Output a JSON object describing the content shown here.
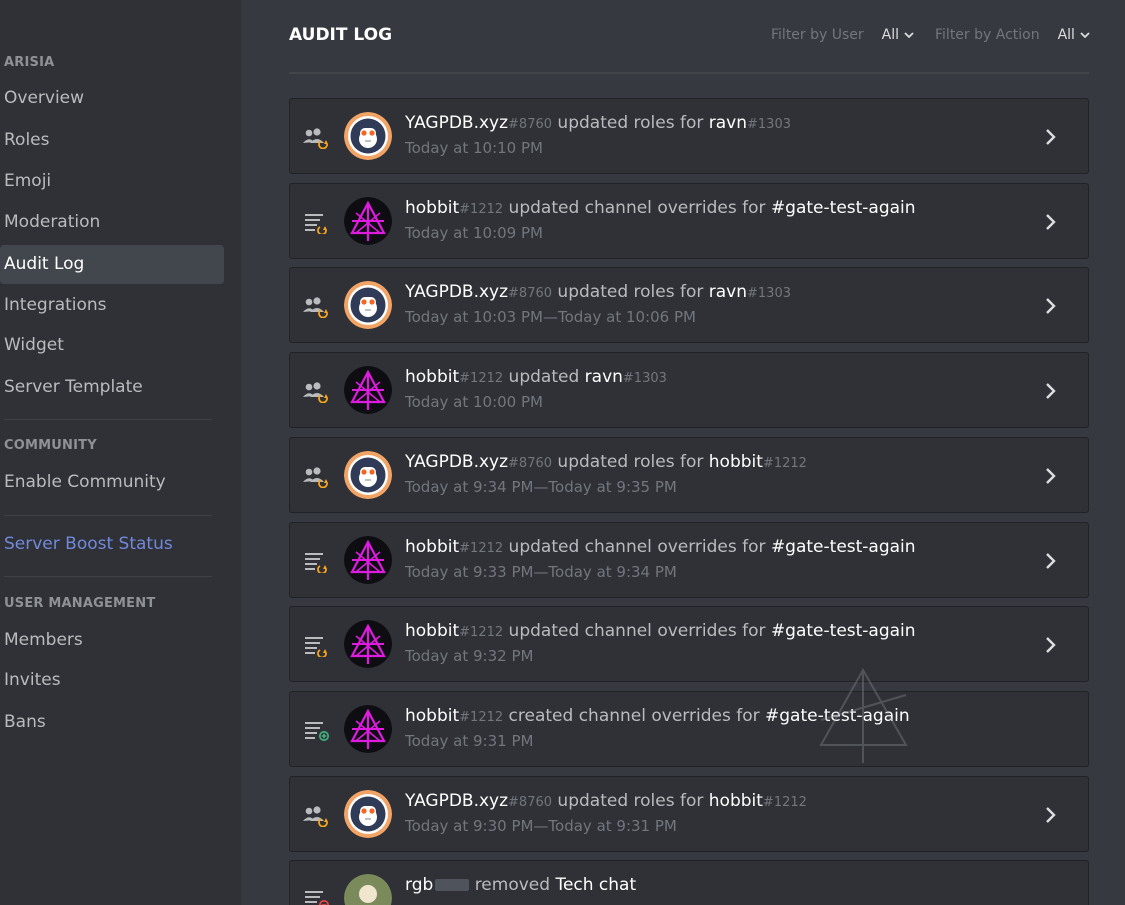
{
  "sidebar": {
    "server_name": "ARISIA",
    "server_items": [
      {
        "label": "Overview",
        "selected": false
      },
      {
        "label": "Roles",
        "selected": false
      },
      {
        "label": "Emoji",
        "selected": false
      },
      {
        "label": "Moderation",
        "selected": false
      },
      {
        "label": "Audit Log",
        "selected": true
      },
      {
        "label": "Integrations",
        "selected": false
      },
      {
        "label": "Widget",
        "selected": false
      },
      {
        "label": "Server Template",
        "selected": false
      }
    ],
    "community_header": "COMMUNITY",
    "community_items": [
      {
        "label": "Enable Community"
      }
    ],
    "boost_label": "Server Boost Status",
    "user_mgmt_header": "USER MANAGEMENT",
    "user_mgmt_items": [
      {
        "label": "Members"
      },
      {
        "label": "Invites"
      },
      {
        "label": "Bans"
      }
    ]
  },
  "header": {
    "title": "AUDIT LOG",
    "filter_user_label": "Filter by User",
    "filter_user_value": "All",
    "filter_action_label": "Filter by Action",
    "filter_action_value": "All"
  },
  "entries": [
    {
      "user": "YAGPDB.xyz",
      "discriminator": "#8760",
      "action": "updated roles for",
      "target": "ravn",
      "target_disc": "#1303",
      "time": "Today at 10:10 PM",
      "icon": "member-role-update-icon",
      "avatar": "yagpdb-avatar",
      "expandable": true
    },
    {
      "user": "hobbit",
      "discriminator": "#1212",
      "action": "updated channel overrides for",
      "target": "#gate-test-again",
      "target_disc": "",
      "time": "Today at 10:09 PM",
      "icon": "channel-override-update-icon",
      "avatar": "hobbit-avatar",
      "expandable": true
    },
    {
      "user": "YAGPDB.xyz",
      "discriminator": "#8760",
      "action": "updated roles for",
      "target": "ravn",
      "target_disc": "#1303",
      "time": "Today at 10:03 PM—Today at 10:06 PM",
      "icon": "member-role-update-icon",
      "avatar": "yagpdb-avatar",
      "expandable": true
    },
    {
      "user": "hobbit",
      "discriminator": "#1212",
      "action": "updated",
      "target": "ravn",
      "target_disc": "#1303",
      "time": "Today at 10:00 PM",
      "icon": "member-role-update-icon",
      "avatar": "hobbit-avatar",
      "expandable": true
    },
    {
      "user": "YAGPDB.xyz",
      "discriminator": "#8760",
      "action": "updated roles for",
      "target": "hobbit",
      "target_disc": "#1212",
      "time": "Today at 9:34 PM—Today at 9:35 PM",
      "icon": "member-role-update-icon",
      "avatar": "yagpdb-avatar",
      "expandable": true
    },
    {
      "user": "hobbit",
      "discriminator": "#1212",
      "action": "updated channel overrides for",
      "target": "#gate-test-again",
      "target_disc": "",
      "time": "Today at 9:33 PM—Today at 9:34 PM",
      "icon": "channel-override-update-icon",
      "avatar": "hobbit-avatar",
      "expandable": true
    },
    {
      "user": "hobbit",
      "discriminator": "#1212",
      "action": "updated channel overrides for",
      "target": "#gate-test-again",
      "target_disc": "",
      "time": "Today at 9:32 PM",
      "icon": "channel-override-update-icon",
      "avatar": "hobbit-avatar",
      "expandable": true
    },
    {
      "user": "hobbit",
      "discriminator": "#1212",
      "action": "created channel overrides for",
      "target": "#gate-test-again",
      "target_disc": "",
      "time": "Today at 9:31 PM",
      "icon": "channel-override-create-icon",
      "avatar": "hobbit-avatar",
      "expandable": false
    },
    {
      "user": "YAGPDB.xyz",
      "discriminator": "#8760",
      "action": "updated roles for",
      "target": "hobbit",
      "target_disc": "#1212",
      "time": "Today at 9:30 PM—Today at 9:31 PM",
      "icon": "member-role-update-icon",
      "avatar": "yagpdb-avatar",
      "expandable": true
    },
    {
      "user": "rgb",
      "discriminator": "",
      "action": "removed",
      "target": "Tech chat",
      "target_disc": "",
      "time": "",
      "icon": "channel-delete-icon",
      "avatar": "rgb-avatar",
      "expandable": false
    }
  ],
  "colors": {
    "sidebar_bg": "#2f3136",
    "main_bg": "#36393f",
    "entry_bg": "#2f3136",
    "boost_blurple": "#7289da",
    "update_icon_orange": "#faa61a",
    "create_icon_green": "#43b581",
    "delete_icon_red": "#f04747",
    "hobbit_avatar_magenta": "#e01be0"
  }
}
